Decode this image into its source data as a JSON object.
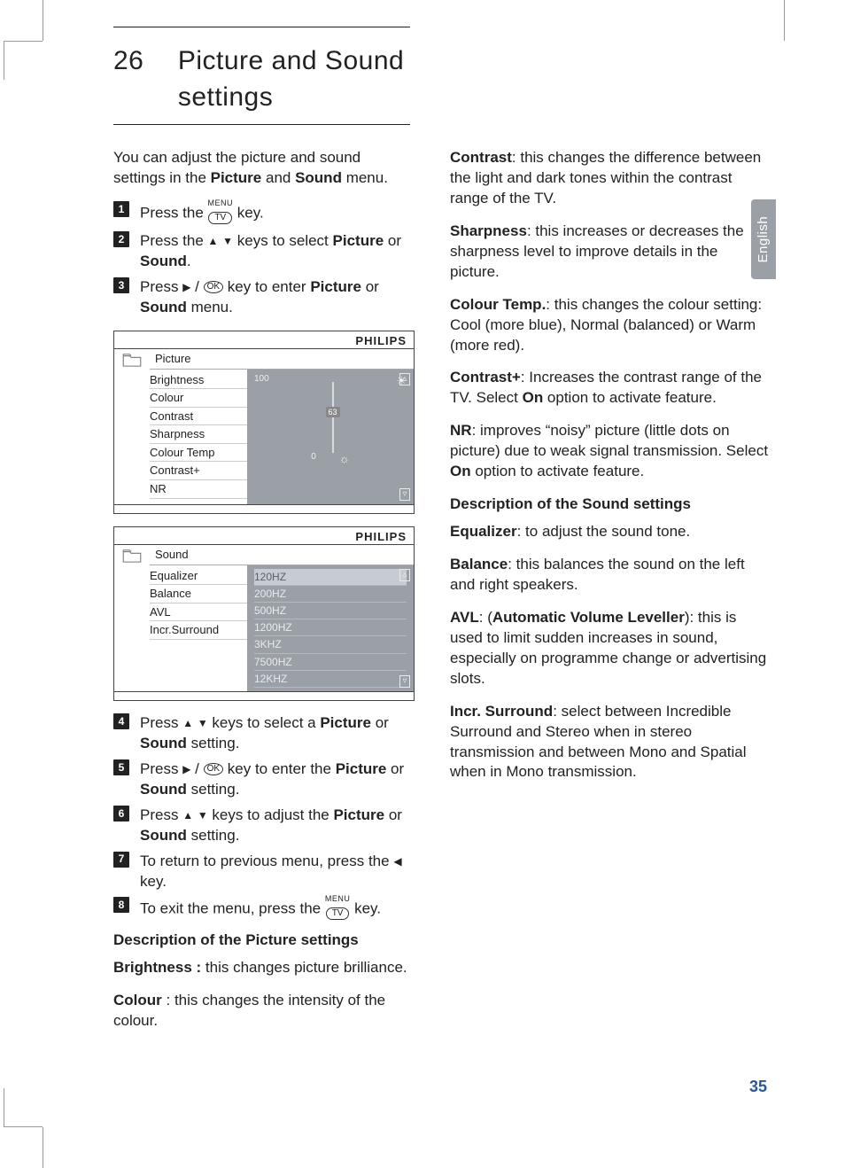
{
  "section": {
    "number": "26",
    "title_line1": "Picture and Sound",
    "title_line2": "settings"
  },
  "intro": {
    "pre": "You can adjust the picture and sound settings in the ",
    "b1": "Picture",
    "mid": " and ",
    "b2": "Sound",
    "post": " menu."
  },
  "tvkey": {
    "menu": "MENU",
    "tv": "TV"
  },
  "okkey": "OK",
  "steps": {
    "s1": {
      "num": "1",
      "a": "Press the ",
      "b": " key."
    },
    "s2": {
      "num": "2",
      "a": "Press the ",
      "b": " keys to select ",
      "c": "Picture",
      "d": " or ",
      "e": "Sound",
      "f": "."
    },
    "s3": {
      "num": "3",
      "a": "Press ",
      "b": " / ",
      "c": " key to enter ",
      "d": "Picture",
      "e": " or ",
      "f": "Sound",
      "g": " menu."
    },
    "s4": {
      "num": "4",
      "a": "Press ",
      "b": " keys to select a ",
      "c": "Picture",
      "d": " or ",
      "e": "Sound",
      "f": " setting."
    },
    "s5": {
      "num": "5",
      "a": "Press ",
      "b": " / ",
      "c": " key to enter the ",
      "d": "Picture",
      "e": " or ",
      "f": "Sound",
      "g": " setting."
    },
    "s6": {
      "num": "6",
      "a": "Press ",
      "b": " keys to adjust the ",
      "c": "Picture",
      "d": " or ",
      "e": "Sound",
      "f": " setting."
    },
    "s7": {
      "num": "7",
      "a": "To return to previous menu, press the ",
      "b": " key."
    },
    "s8": {
      "num": "8",
      "a": "To exit the menu, press the ",
      "b": " key."
    }
  },
  "osd_brand": "PHILIPS",
  "osd1": {
    "title": "Picture",
    "items": [
      "Brightness",
      "Colour",
      "Contrast",
      "Sharpness",
      "Colour Temp",
      "Contrast+",
      "NR"
    ],
    "slider": {
      "top": "100",
      "current": "63",
      "bottom": "0"
    }
  },
  "osd2": {
    "title": "Sound",
    "left": [
      "Equalizer",
      "Balance",
      "AVL",
      "Incr.Surround"
    ],
    "right": [
      "120HZ",
      "200HZ",
      "500HZ",
      "1200HZ",
      "3KHZ",
      "7500HZ",
      "12KHZ"
    ]
  },
  "pic_heading": "Description of the Picture settings",
  "pic": {
    "brightness": {
      "t": "Brightness : ",
      "d": "this changes picture brilliance."
    },
    "colour": {
      "t": "Colour",
      "d": " : this changes the intensity of the colour."
    },
    "contrast": {
      "t": "Contrast",
      "d": ": this changes the difference between the light and dark tones within the contrast range of the TV."
    },
    "sharpness": {
      "t": "Sharpness",
      "d": ": this increases or decreases the sharpness level to improve details in the picture."
    },
    "ctemp": {
      "t": "Colour Temp.",
      "d": ":  this changes the colour setting: Cool (more blue), Normal (balanced) or Warm (more red)."
    },
    "cplus": {
      "t": "Contrast+",
      "a": ": Increases the contrast range of the TV. Select ",
      "b": "On",
      "c": " option to activate feature."
    },
    "nr": {
      "t": "NR",
      "a": ": improves “noisy” picture (little dots on picture) due to weak signal transmission. Select ",
      "b": "On",
      "c": " option to activate feature."
    }
  },
  "snd_heading": "Description of the Sound settings",
  "snd": {
    "eq": {
      "t": "Equalizer",
      "d": ": to adjust the sound tone."
    },
    "bal": {
      "t": "Balance",
      "d": ": this balances the sound on the left and right speakers."
    },
    "avl": {
      "t": "AVL",
      "a": ": (",
      "b": "Automatic  Volume Leveller",
      "c": "): this is used to limit sudden  increases in sound, especially on programme change or advertising slots."
    },
    "incr": {
      "t": "Incr. Surround",
      "d": ": select between Incredible Surround  and Stereo when in stereo transmission and between Mono and Spatial when in Mono transmission."
    }
  },
  "language_tab": "English",
  "page_number": "35"
}
